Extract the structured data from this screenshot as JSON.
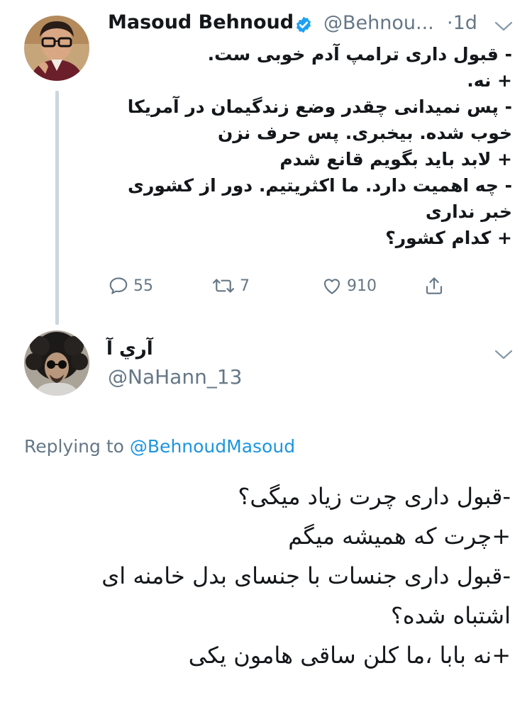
{
  "tweet1": {
    "author_name": "Masoud Behnoud",
    "handle": "@Behnou...",
    "time": "·1d",
    "lines": [
      "- قبول داری ترامپ آدم خوبی ست.",
      "+ نه.",
      "- پس نمیدانی چقدر وضع زندگیمان در آمریکا",
      "خوب شده. بیخبری. پس حرف نزن",
      "+ لابد باید بگویم قانع شدم",
      "- چه اهمیت دارد. ما اکثریتیم. دور از کشوری",
      "خبر نداری",
      "+ کدام کشور؟"
    ],
    "actions": {
      "replies": "55",
      "retweets": "7",
      "likes": "910"
    }
  },
  "tweet2": {
    "author_name": "آري آ",
    "handle": "@NaHann_13",
    "replying_prefix": "Replying to",
    "replying_to": "@BehnoudMasoud",
    "lines": [
      "-قبول داری چرت زیاد میگی؟",
      "+چرت که همیشه میگم",
      "-قبول داری جنسات با جنسای بدل خامنه ای",
      "اشتباه شده؟",
      "+نه بابا ،ما کلن ساقی هامون یکی"
    ]
  },
  "colors": {
    "text": "#14171a",
    "secondary": "#657786",
    "link": "#1b95e0",
    "verified": "#1da1f2",
    "thread_line": "#ccd6dd"
  },
  "icons": [
    "verified-badge-icon",
    "chevron-down-icon",
    "reply-icon",
    "retweet-icon",
    "like-icon",
    "share-icon"
  ]
}
